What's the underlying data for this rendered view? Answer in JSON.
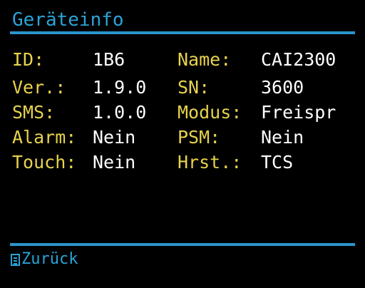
{
  "header": {
    "title": "Geräteinfo"
  },
  "info": {
    "rows": [
      {
        "label_left": "ID:",
        "value_left": "1B6",
        "label_right": "Name:",
        "value_right": "CAI2300"
      },
      {
        "label_left": "Ver.:",
        "value_left": "1.9.0",
        "label_right": "SN:",
        "value_right": "3600"
      },
      {
        "label_left": "SMS:",
        "value_left": "1.0.0",
        "label_right": "Modus:",
        "value_right": "Freispr"
      },
      {
        "label_left": "Alarm:",
        "value_left": "Nein",
        "label_right": "PSM:",
        "value_right": "Nein"
      },
      {
        "label_left": "Touch:",
        "value_left": "Nein",
        "label_right": "Hrst.:",
        "value_right": "TCS"
      }
    ]
  },
  "footer": {
    "back_icon": "list-icon",
    "back_label": "Zurück"
  },
  "colors": {
    "background": "#000000",
    "accent": "#2ba3d8",
    "label": "#e7d24d",
    "value": "#ffffff"
  }
}
